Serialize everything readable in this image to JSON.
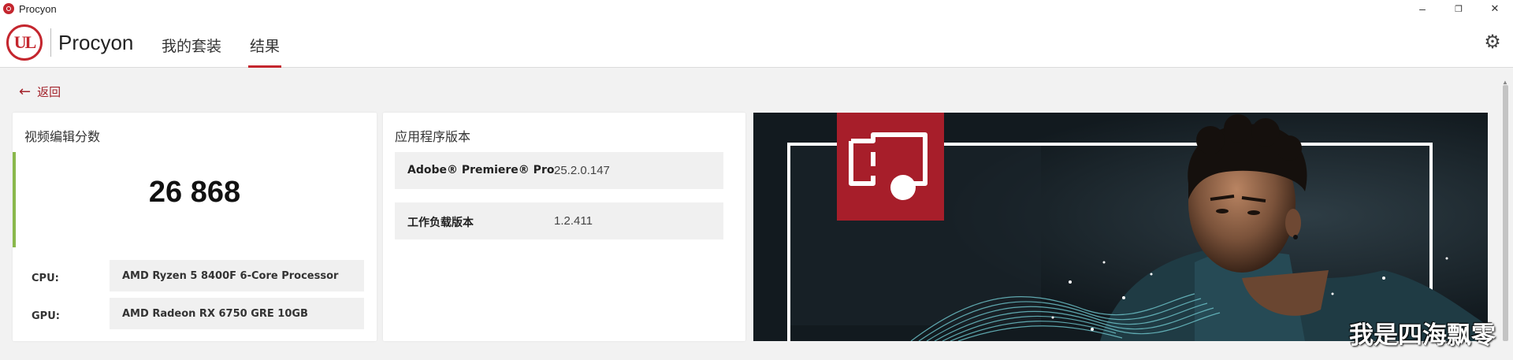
{
  "window": {
    "title": "Procyon",
    "minimize_glyph": "–",
    "maximize_glyph": "❐",
    "close_glyph": "✕"
  },
  "header": {
    "logo_text": "UL",
    "app_name": "Procyon",
    "tabs": [
      {
        "label": "我的套装",
        "active": false
      },
      {
        "label": "结果",
        "active": true
      }
    ],
    "settings_icon": "gear-icon"
  },
  "back": {
    "label": "返回"
  },
  "score_card": {
    "title": "视频编辑分数",
    "score": "26 868",
    "cpu_label": "CPU:",
    "cpu_value": "AMD Ryzen 5 8400F 6-Core Processor",
    "gpu_label": "GPU:",
    "gpu_value": "AMD Radeon RX 6750 GRE 10GB"
  },
  "version_card": {
    "title": "应用程序版本",
    "rows": [
      {
        "name": "Adobe® Premiere® Pro",
        "value": "25.2.0.147"
      },
      {
        "name": "工作负载版本",
        "value": "1.2.411"
      }
    ]
  },
  "banner": {
    "icon": "video-editing-icon"
  },
  "watermark": "我是四海飘零",
  "colors": {
    "accent_red": "#c4262e",
    "score_accent": "#8ab84c",
    "banner_bg": "#151d22"
  }
}
